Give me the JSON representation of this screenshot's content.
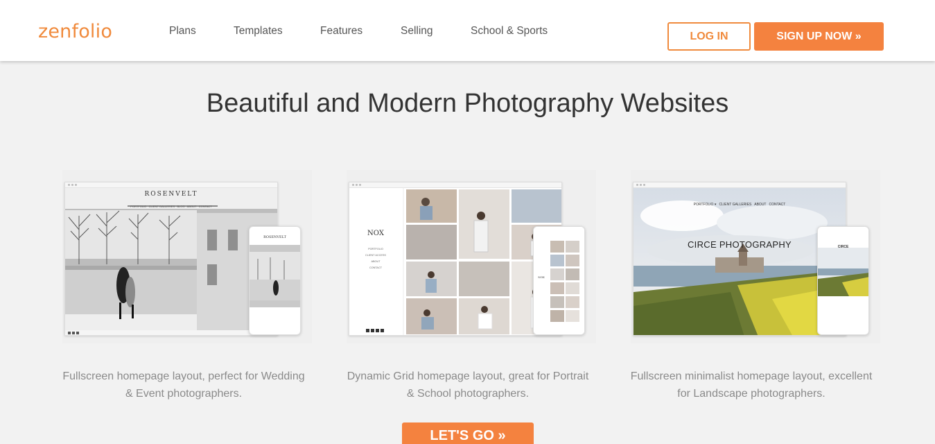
{
  "header": {
    "logo": "zenfolio",
    "nav": [
      {
        "label": "Plans"
      },
      {
        "label": "Templates"
      },
      {
        "label": "Features"
      },
      {
        "label": "Selling"
      },
      {
        "label": "School & Sports"
      }
    ],
    "login_label": "LOG IN",
    "signup_label": "SIGN UP NOW »"
  },
  "headline": "Beautiful and Modern Photography Websites",
  "cards": [
    {
      "template_name": "ROSENVELT",
      "mini_nav": "PORTFOLIO   CLIENT GALLERIES   BLOG   ABOUT   CONTACT",
      "phone_title": "ROSENVELT",
      "desc_line1": "Fullscreen homepage layout, perfect for Wedding",
      "desc_line2": "& Event photographers."
    },
    {
      "template_name": "NOX",
      "mini_nav_items": [
        "PORTFOLIO",
        "CLIENT ACCESS",
        "ABOUT",
        "CONTACT"
      ],
      "phone_title": "NOX",
      "desc_line1": "Dynamic Grid homepage layout, great for Portrait",
      "desc_line2": "& School photographers."
    },
    {
      "template_name": "CIRCE PHOTOGRAPHY",
      "mini_nav": "PORTFOLIO ▾   CLIENT GALLERIES   ABOUT   CONTACT",
      "phone_title": "CIRCE",
      "desc_line1": "Fullscreen minimalist homepage layout, excellent",
      "desc_line2": "for Landscape photographers."
    }
  ],
  "cta_label": "LET'S GO »",
  "colors": {
    "accent": "#f4823f",
    "background": "#f2f2f2",
    "header_bg": "#ffffff",
    "muted_text": "#8a8a8a"
  }
}
